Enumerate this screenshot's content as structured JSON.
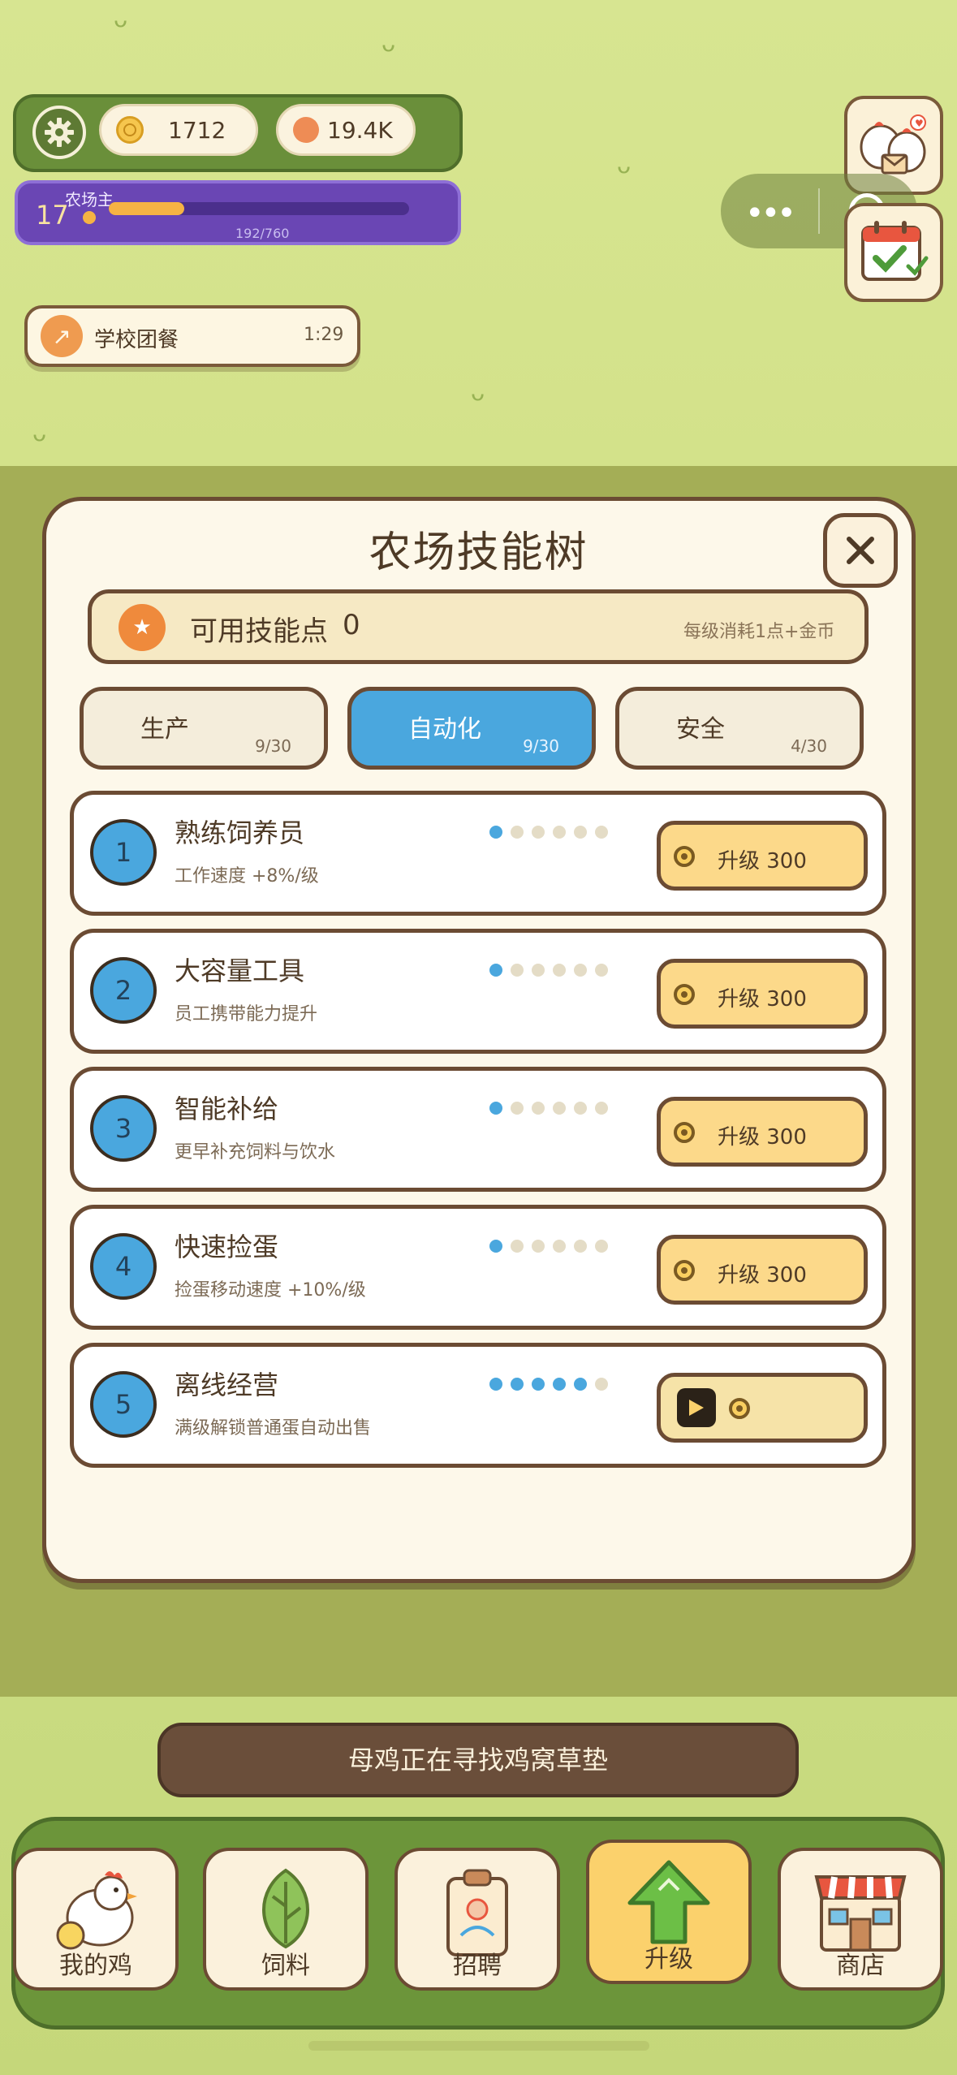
{
  "hud": {
    "coins": "1712",
    "eggs": "19.4K",
    "level": "17",
    "level_title": "农场主",
    "xp_text": "192/760",
    "xp_progress": 0.2526
  },
  "task": {
    "icon": "arrow-up-right-icon",
    "label": "学校团餐",
    "time": "1:29"
  },
  "modal": {
    "title": "农场技能树",
    "points_label": "可用技能点",
    "points_value": "0",
    "points_note": "每级消耗1点+金币",
    "tabs": [
      {
        "label": "生产",
        "count": "9/30",
        "active": false
      },
      {
        "label": "自动化",
        "count": "9/30",
        "active": true
      },
      {
        "label": "安全",
        "count": "4/30",
        "active": false
      }
    ],
    "skills": [
      {
        "num": "1",
        "name": "熟练饲养员",
        "desc": "工作速度 +8%/级",
        "level": 1,
        "max_level": 6,
        "button": "升级 300"
      },
      {
        "num": "2",
        "name": "大容量工具",
        "desc": "员工携带能力提升",
        "level": 1,
        "max_level": 6,
        "button": "升级 300"
      },
      {
        "num": "3",
        "name": "智能补给",
        "desc": "更早补充饲料与饮水",
        "level": 1,
        "max_level": 6,
        "button": "升级 300"
      },
      {
        "num": "4",
        "name": "快速捡蛋",
        "desc": "捡蛋移动速度 +10%/级",
        "level": 1,
        "max_level": 6,
        "button": "升级 300"
      },
      {
        "num": "5",
        "name": "离线经营",
        "desc": "满级解锁普通蛋自动出售",
        "level": 5,
        "max_level": 6,
        "button": ""
      }
    ]
  },
  "toast": "母鸡正在寻找鸡窝草垫",
  "nav": [
    {
      "label": "我的鸡",
      "icon": "hen-icon"
    },
    {
      "label": "饲料",
      "icon": "leaf-icon"
    },
    {
      "label": "招聘",
      "icon": "id-badge-icon"
    },
    {
      "label": "升级",
      "icon": "up-arrow-icon",
      "active": true
    },
    {
      "label": "商店",
      "icon": "shop-icon"
    }
  ],
  "colors": {
    "accent_blue": "#4aa7de",
    "coin_yellow": "#fcd98a",
    "border_brown": "#6b4b33",
    "xp_orange": "#f6b344"
  }
}
